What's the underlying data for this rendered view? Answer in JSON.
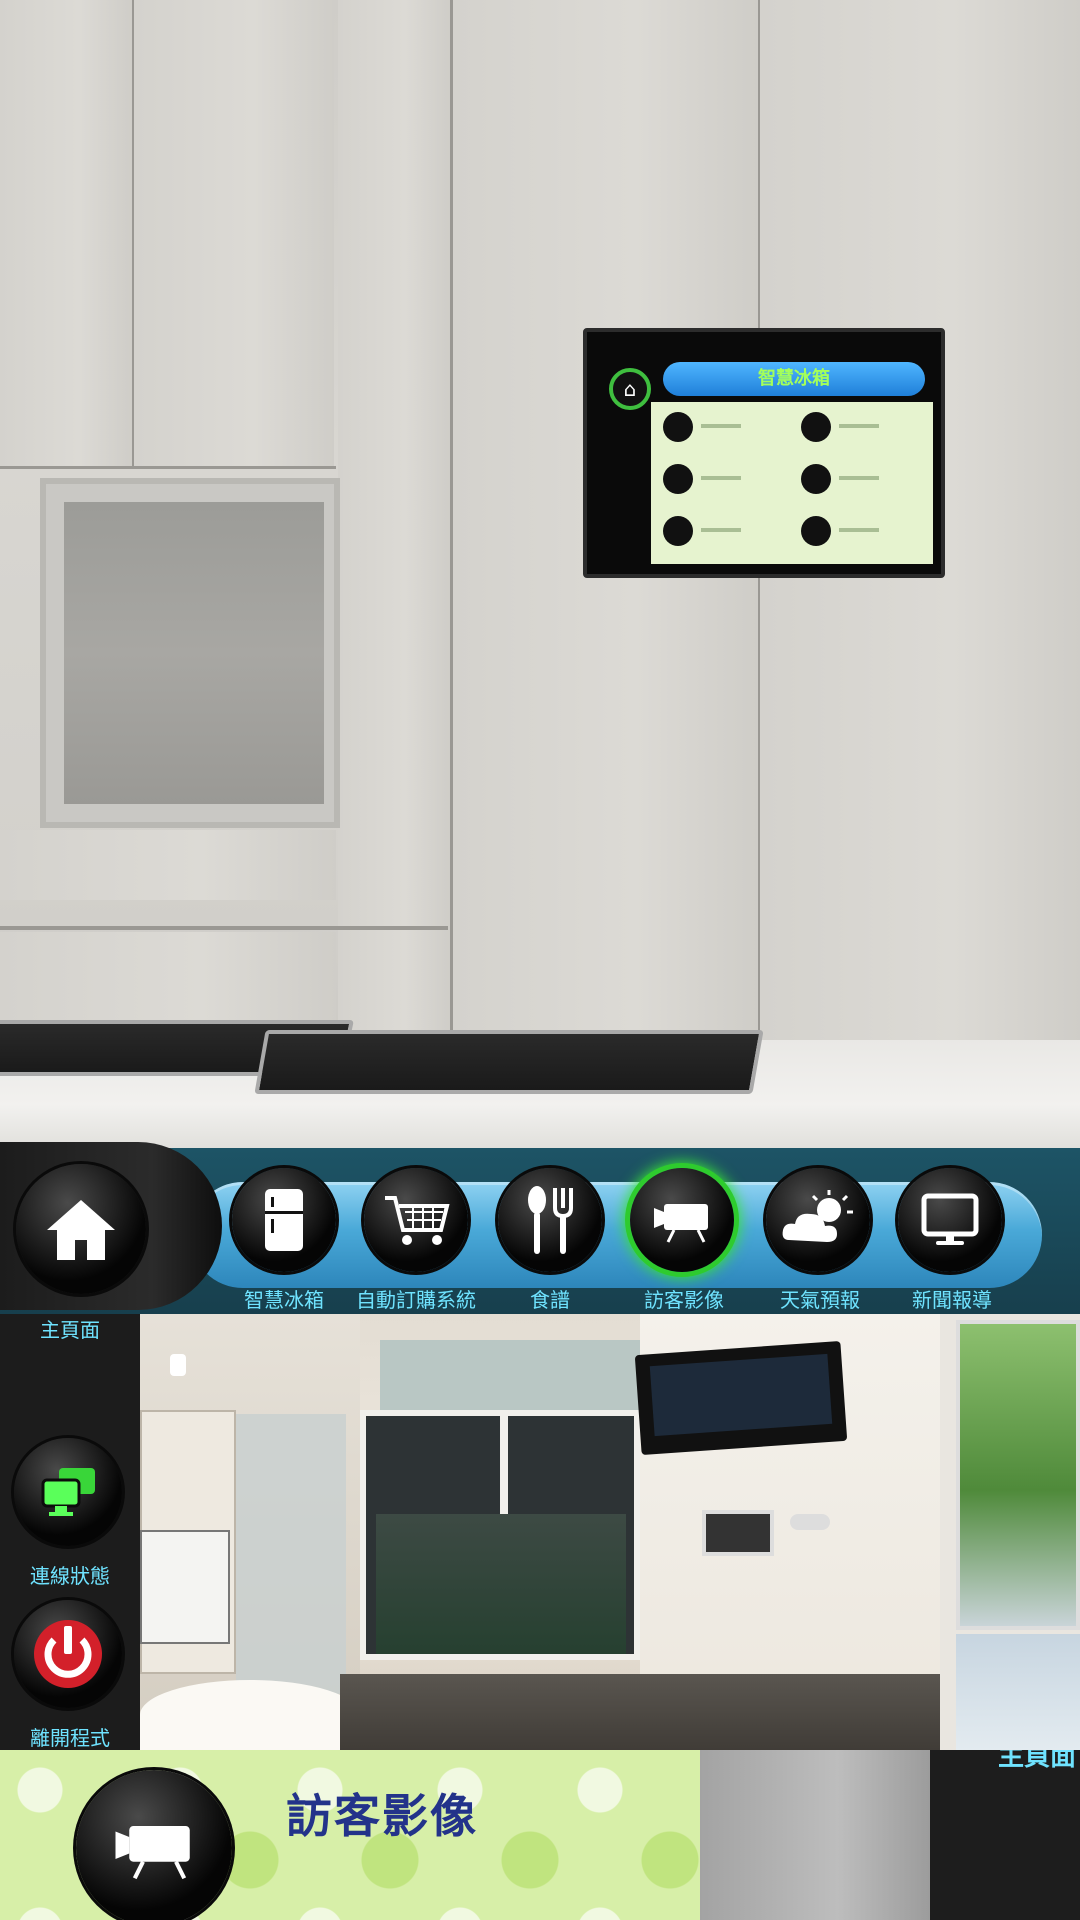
{
  "wall_tablet": {
    "title": "智慧冰箱"
  },
  "nav": {
    "items": [
      {
        "label": "智慧冰箱",
        "icon": "fridge-icon"
      },
      {
        "label": "自動訂購系統",
        "icon": "shopping-cart-icon"
      },
      {
        "label": "食譜",
        "icon": "spoon-fork-icon"
      },
      {
        "label": "訪客影像",
        "icon": "video-camera-icon",
        "active": true
      },
      {
        "label": "天氣預報",
        "icon": "weather-icon"
      },
      {
        "label": "新聞報導",
        "icon": "monitor-icon"
      }
    ]
  },
  "sidebar": {
    "home_label": "主頁面",
    "connection_label": "連線狀態",
    "exit_label": "離開程式"
  },
  "bottom": {
    "title": "訪客影像",
    "cut_label": "主頁面"
  },
  "colors": {
    "label": "#6fe3ff",
    "active_ring": "#2ecb2e",
    "bar": "#1d5466",
    "capsule": "#4aa9d8",
    "title": "#23338a"
  }
}
